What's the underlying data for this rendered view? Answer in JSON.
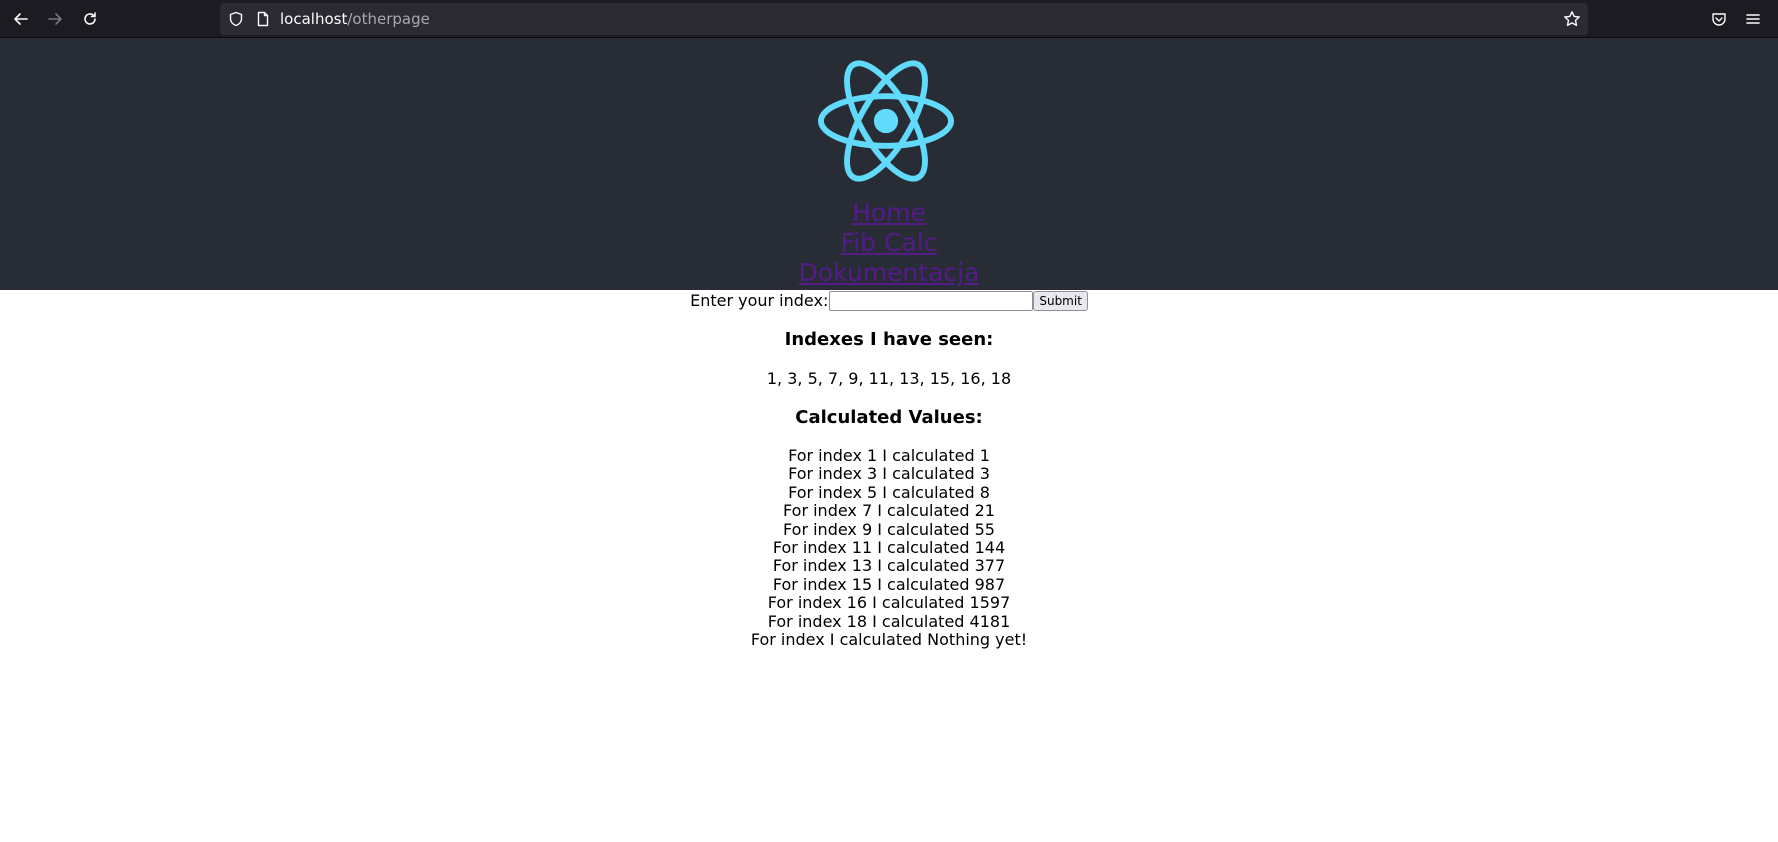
{
  "browser": {
    "url_host": "localhost",
    "url_path": "/otherpage"
  },
  "nav": {
    "links": [
      "Home",
      "Fib Calc",
      "Dokumentacja"
    ]
  },
  "colors": {
    "header_bg": "#282c34",
    "logo": "#61dafb",
    "link": "#551a8b"
  },
  "form": {
    "label": "Enter your index:",
    "value": "",
    "submit_label": "Submit"
  },
  "seen": {
    "title": "Indexes I have seen:",
    "values": "1, 3, 5, 7, 9, 11, 13, 15, 16, 18"
  },
  "calculated": {
    "title": "Calculated Values:",
    "items": [
      "For index 1 I calculated 1",
      "For index 3 I calculated 3",
      "For index 5 I calculated 8",
      "For index 7 I calculated 21",
      "For index 9 I calculated 55",
      "For index 11 I calculated 144",
      "For index 13 I calculated 377",
      "For index 15 I calculated 987",
      "For index 16 I calculated 1597",
      "For index 18 I calculated 4181",
      "For index I calculated Nothing yet!"
    ]
  }
}
